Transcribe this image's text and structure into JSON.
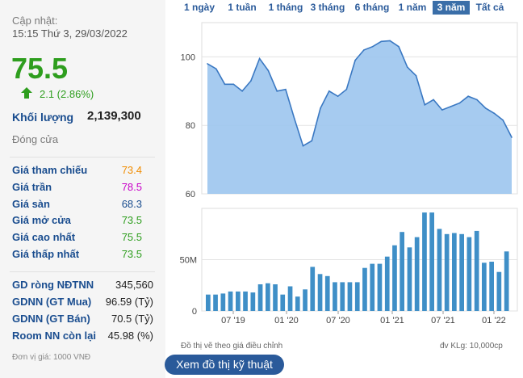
{
  "quote": {
    "updated_label": "Cập nhật:",
    "updated_time": "15:15 Thứ 3, 29/03/2022",
    "price": "75.5",
    "change": "2.1 (2.86%)",
    "volume_label": "Khối lượng",
    "volume": "2,139,300",
    "status": "Đóng cửa"
  },
  "prices": [
    {
      "label": "Giá tham chiếu",
      "value": "73.4",
      "color": "#f08c00"
    },
    {
      "label": "Giá trần",
      "value": "78.5",
      "color": "#c800c8"
    },
    {
      "label": "Giá sàn",
      "value": "68.3",
      "color": "#1a4d8f"
    },
    {
      "label": "Giá mở cửa",
      "value": "73.5",
      "color": "#2e9e1e"
    },
    {
      "label": "Giá cao nhất",
      "value": "75.5",
      "color": "#2e9e1e"
    },
    {
      "label": "Giá thấp nhất",
      "value": "73.5",
      "color": "#2e9e1e"
    }
  ],
  "foreign": [
    {
      "label": "GD ròng NĐTNN",
      "value": "345,560"
    },
    {
      "label": "GDNN (GT Mua)",
      "value": "96.59 (Tỷ)"
    },
    {
      "label": "GDNN (GT Bán)",
      "value": "70.5 (Tỷ)"
    },
    {
      "label": "Room NN còn lại",
      "value": "45.98 (%)"
    }
  ],
  "unit_note": "Đơn vị giá: 1000 VNĐ",
  "tabs": [
    "1 ngày",
    "1 tuần",
    "1 tháng",
    "3 tháng",
    "6 tháng",
    "1 năm",
    "3 năm",
    "Tất cả"
  ],
  "active_tab": "3 năm",
  "chart_notes": {
    "left": "Đồ thị vẽ theo giá điều chỉnh",
    "right": "đv KLg: 10,000cp"
  },
  "tech_button": "Xem đồ thị kỹ thuật",
  "colors": {
    "price_up": "#2e9e1e",
    "area_fill": "#9cc5ee",
    "line": "#3a78c2",
    "bar": "#3f8fc7",
    "label": "#1a4d8f"
  },
  "chart_data": [
    {
      "type": "area",
      "ylim": [
        60,
        110
      ],
      "yticks": [
        60,
        80,
        100
      ],
      "xticks": [
        "07 '19",
        "01 '20",
        "07 '20",
        "01 '21",
        "07 '21",
        "01 '22"
      ],
      "values": [
        98,
        96.5,
        92,
        92,
        90,
        93,
        99.5,
        96,
        90,
        90.5,
        82,
        74,
        75.5,
        85,
        90,
        88.5,
        90.5,
        99,
        102,
        103,
        104.5,
        104.7,
        103,
        97,
        94.5,
        86,
        87.5,
        84.5,
        85.5,
        86.5,
        88.5,
        87.5,
        85,
        83.5,
        81.5,
        76.5
      ]
    },
    {
      "type": "bar",
      "yticks": [
        0,
        50
      ],
      "ytick_labels": [
        "0",
        "50M"
      ],
      "ylim": [
        0,
        100
      ],
      "xticks": [
        "07 '19",
        "01 '20",
        "07 '20",
        "01 '21",
        "07 '21",
        "01 '22"
      ],
      "values": [
        16,
        16,
        17,
        19,
        19,
        19,
        18,
        26,
        27,
        26,
        16,
        24,
        14,
        21,
        43,
        36,
        34,
        28,
        28,
        28,
        28,
        42,
        46,
        46,
        53,
        64,
        77,
        62,
        72,
        96,
        96,
        80,
        75,
        76,
        75,
        72,
        78,
        47,
        48,
        38,
        58
      ]
    }
  ]
}
